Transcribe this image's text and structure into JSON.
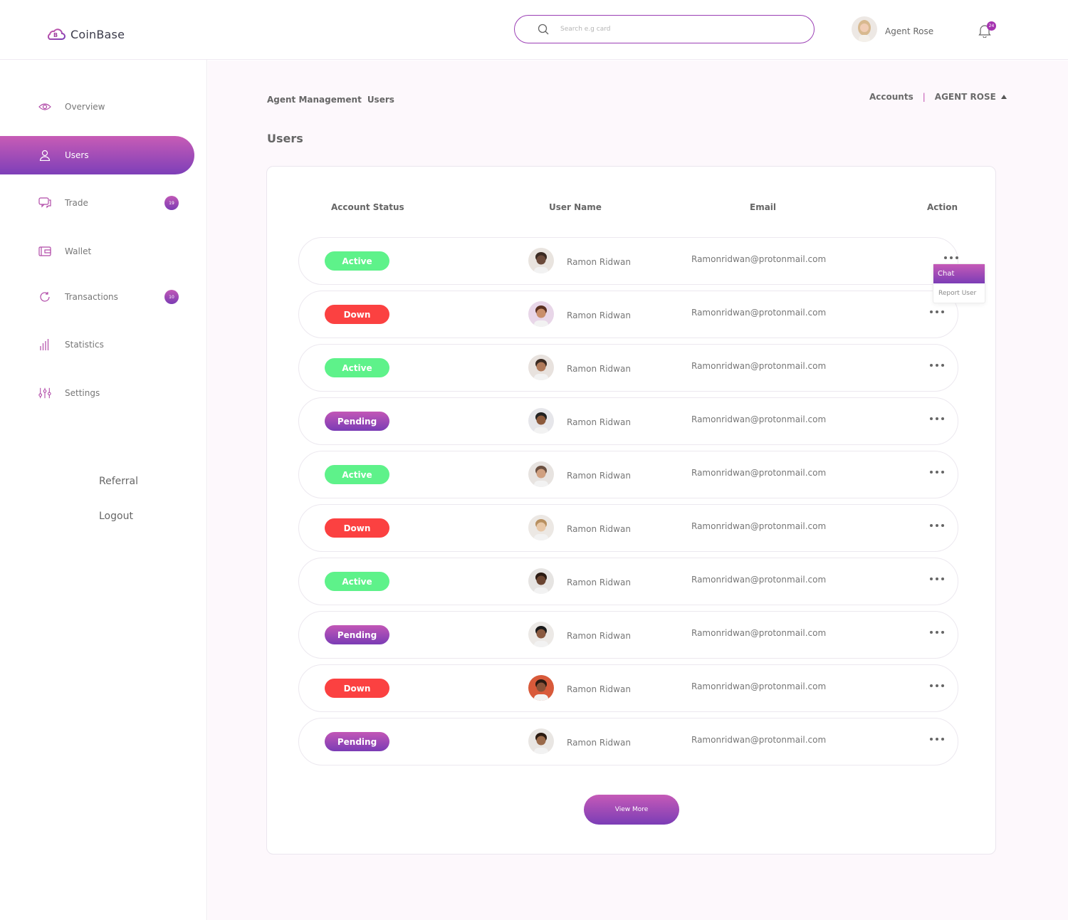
{
  "brand": {
    "name": "CoinBase"
  },
  "search": {
    "placeholder": "Search e.g card"
  },
  "profile": {
    "name": "Agent Rose"
  },
  "notifications": {
    "count": "24"
  },
  "sidebar": {
    "items": [
      {
        "key": "overview",
        "label": "Overview",
        "icon": "eye-icon",
        "badge": ""
      },
      {
        "key": "users",
        "label": "Users",
        "icon": "user-icon",
        "badge": ""
      },
      {
        "key": "trade",
        "label": "Trade",
        "icon": "chat-icon",
        "badge": "19"
      },
      {
        "key": "wallet",
        "label": "Wallet",
        "icon": "wallet-icon",
        "badge": ""
      },
      {
        "key": "transactions",
        "label": "Transactions",
        "icon": "refresh-icon",
        "badge": "10"
      },
      {
        "key": "statistics",
        "label": "Statistics",
        "icon": "bar-chart-icon",
        "badge": ""
      },
      {
        "key": "settings",
        "label": "Settings",
        "icon": "sliders-icon",
        "badge": ""
      }
    ],
    "active": "users",
    "referral": "Referral",
    "logout": "Logout"
  },
  "breadcrumb": {
    "section": "Agent Management",
    "page": "Users"
  },
  "top_links": {
    "accounts": "Accounts",
    "separator": "|",
    "agent": "AGENT ROSE"
  },
  "page_title": "Users",
  "table": {
    "headers": {
      "status": "Account Status",
      "name": "User Name",
      "email": "Email",
      "action": "Action"
    },
    "rows": [
      {
        "status": "Active",
        "type": "active",
        "name": "Ramon Ridwan",
        "email": "Ramonridwan@protonmail.com"
      },
      {
        "status": "Down",
        "type": "down",
        "name": "Ramon Ridwan",
        "email": "Ramonridwan@protonmail.com"
      },
      {
        "status": "Active",
        "type": "active",
        "name": "Ramon Ridwan",
        "email": "Ramonridwan@protonmail.com"
      },
      {
        "status": "Pending",
        "type": "pending",
        "name": "Ramon Ridwan",
        "email": "Ramonridwan@protonmail.com"
      },
      {
        "status": "Active",
        "type": "active",
        "name": "Ramon Ridwan",
        "email": "Ramonridwan@protonmail.com"
      },
      {
        "status": "Down",
        "type": "down",
        "name": "Ramon Ridwan",
        "email": "Ramonridwan@protonmail.com"
      },
      {
        "status": "Active",
        "type": "active",
        "name": "Ramon Ridwan",
        "email": "Ramonridwan@protonmail.com"
      },
      {
        "status": "Pending",
        "type": "pending",
        "name": "Ramon Ridwan",
        "email": "Ramonridwan@protonmail.com"
      },
      {
        "status": "Down",
        "type": "down",
        "name": "Ramon Ridwan",
        "email": "Ramonridwan@protonmail.com"
      },
      {
        "status": "Pending",
        "type": "pending",
        "name": "Ramon Ridwan",
        "email": "Ramonridwan@protonmail.com"
      }
    ]
  },
  "action_menu": {
    "chat": "Chat",
    "report": "Report User"
  },
  "view_more": "View More",
  "colors": {
    "accent": "#9b3fb5",
    "active": "#5ef28a",
    "down": "#fb4141",
    "pending": "#8a40b5"
  }
}
